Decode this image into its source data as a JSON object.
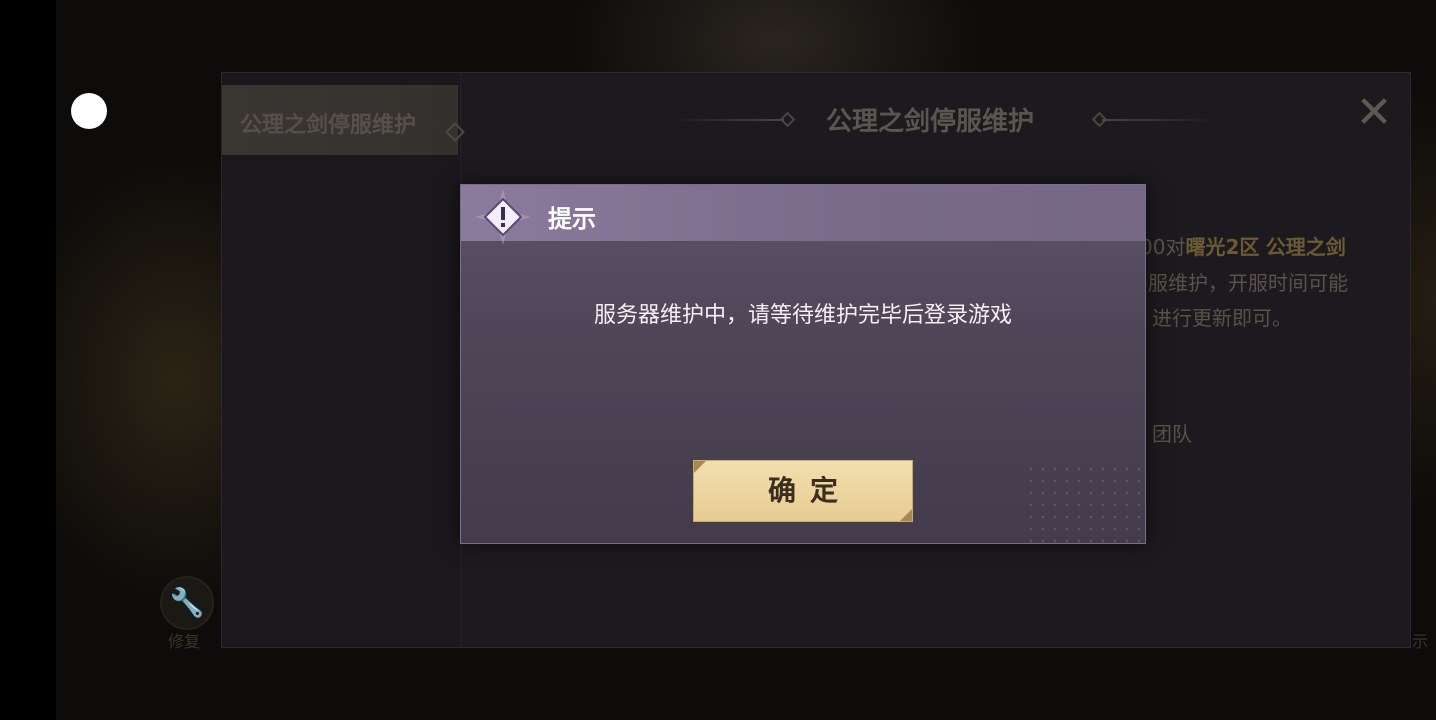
{
  "background": {
    "tool_label": "修复",
    "right_label": "示"
  },
  "panel": {
    "side_tab_label": "公理之剑停服维护",
    "title": "公理之剑停服维护",
    "body_lines": [
      {
        "prefix": "00对",
        "highlight1": "曙光2区",
        "highlight2": "公理之剑"
      },
      {
        "text": "服维护，开服时间可能"
      },
      {
        "text": "进行更新即可。"
      },
      {
        "text": "团队"
      }
    ]
  },
  "dialog": {
    "title": "提示",
    "message": "服务器维护中，请等待维护完毕后登录游戏",
    "confirm_label": "确定"
  },
  "colors": {
    "dialog_header": "#8b7b9c",
    "dialog_body": "#4f4658",
    "confirm_button": "#ecd49f",
    "highlight_gold": "#c9a24e"
  }
}
